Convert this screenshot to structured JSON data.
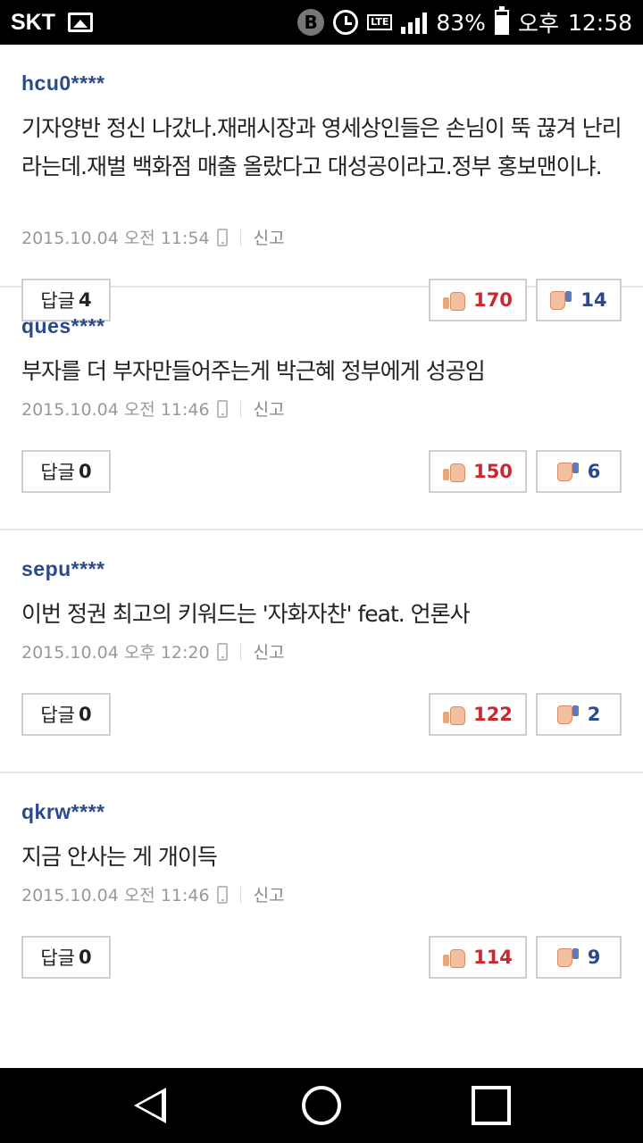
{
  "status_bar": {
    "carrier": "SKT",
    "bt_icon": "B",
    "lte": "LTE",
    "battery": "83%",
    "ampm": "오후",
    "time": "12:58"
  },
  "reply_label": "답글",
  "report_label": "신고",
  "comments": [
    {
      "user": "hcu0****",
      "text": "기자양반 정신 나갔나.재래시장과 영세상인들은 손님이 뚝 끊겨 난리라는데.재벌 백화점 매출 올랐다고 대성공이라고.정부 홍보맨이냐.",
      "date": "2015.10.04 오전 11:54",
      "replies": "4",
      "likes": "170",
      "dislikes": "14"
    },
    {
      "user": "ques****",
      "text": "부자를 더 부자만들어주는게 박근혜 정부에게 성공임",
      "date": "2015.10.04 오전 11:46",
      "replies": "0",
      "likes": "150",
      "dislikes": "6"
    },
    {
      "user": "sepu****",
      "text": "이번 정권 최고의 키워드는 '자화자찬' feat. 언론사",
      "date": "2015.10.04 오후 12:20",
      "replies": "0",
      "likes": "122",
      "dislikes": "2"
    },
    {
      "user": "qkrw****",
      "text": "지금 안사는 게 개이득",
      "date": "2015.10.04 오전 11:46",
      "replies": "0",
      "likes": "114",
      "dislikes": "9"
    }
  ]
}
